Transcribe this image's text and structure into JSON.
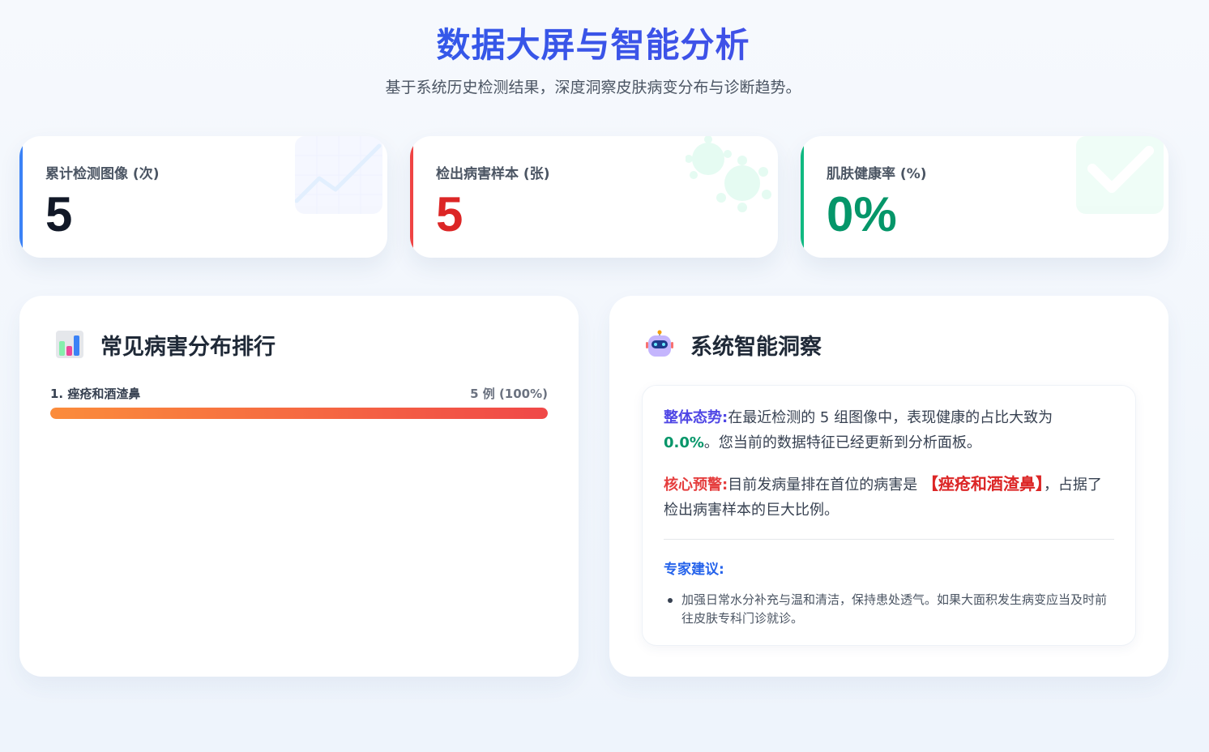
{
  "header": {
    "title": "数据大屏与智能分析",
    "subtitle": "基于系统历史检测结果，深度洞察皮肤病变分布与诊断趋势。"
  },
  "stats": [
    {
      "label": "累计检测图像 (次)",
      "value": "5",
      "accent": "#3b82f6",
      "value_color": "#111827",
      "icon": "chart-trend-icon"
    },
    {
      "label": "检出病害样本 (张)",
      "value": "5",
      "accent": "#ef4444",
      "value_color": "#dc2626",
      "icon": "virus-icon"
    },
    {
      "label": "肌肤健康率 (%)",
      "value": "0%",
      "accent": "#10b981",
      "value_color": "#059669",
      "icon": "checkmark-icon"
    }
  ],
  "ranking": {
    "title": "常见病害分布排行",
    "icon": "bar-chart-icon",
    "items": [
      {
        "name": "1. 痤疮和酒渣鼻",
        "count_text": "5 例 (100%)",
        "percent": 100
      }
    ]
  },
  "insights": {
    "title": "系统智能洞察",
    "icon": "robot-icon",
    "overall_label": "整体态势:",
    "overall_text_1": "在最近检测的 5 组图像中，表现健康的占比大致为",
    "overall_value": "0.0%",
    "overall_text_2": "。您当前的数据特征已经更新到分析面板。",
    "warning_label": "核心预警:",
    "warning_text_1": "目前发病量排在首位的病害是",
    "warning_highlight": "【痤疮和酒渣鼻】",
    "warning_text_2": "，占据了检出病害样本的巨大比例。",
    "advice_title": "专家建议:",
    "advice_items": [
      "加强日常水分补充与温和清洁，保持患处透气。如果大面积发生病变应当及时前往皮肤专科门诊就诊。"
    ]
  }
}
